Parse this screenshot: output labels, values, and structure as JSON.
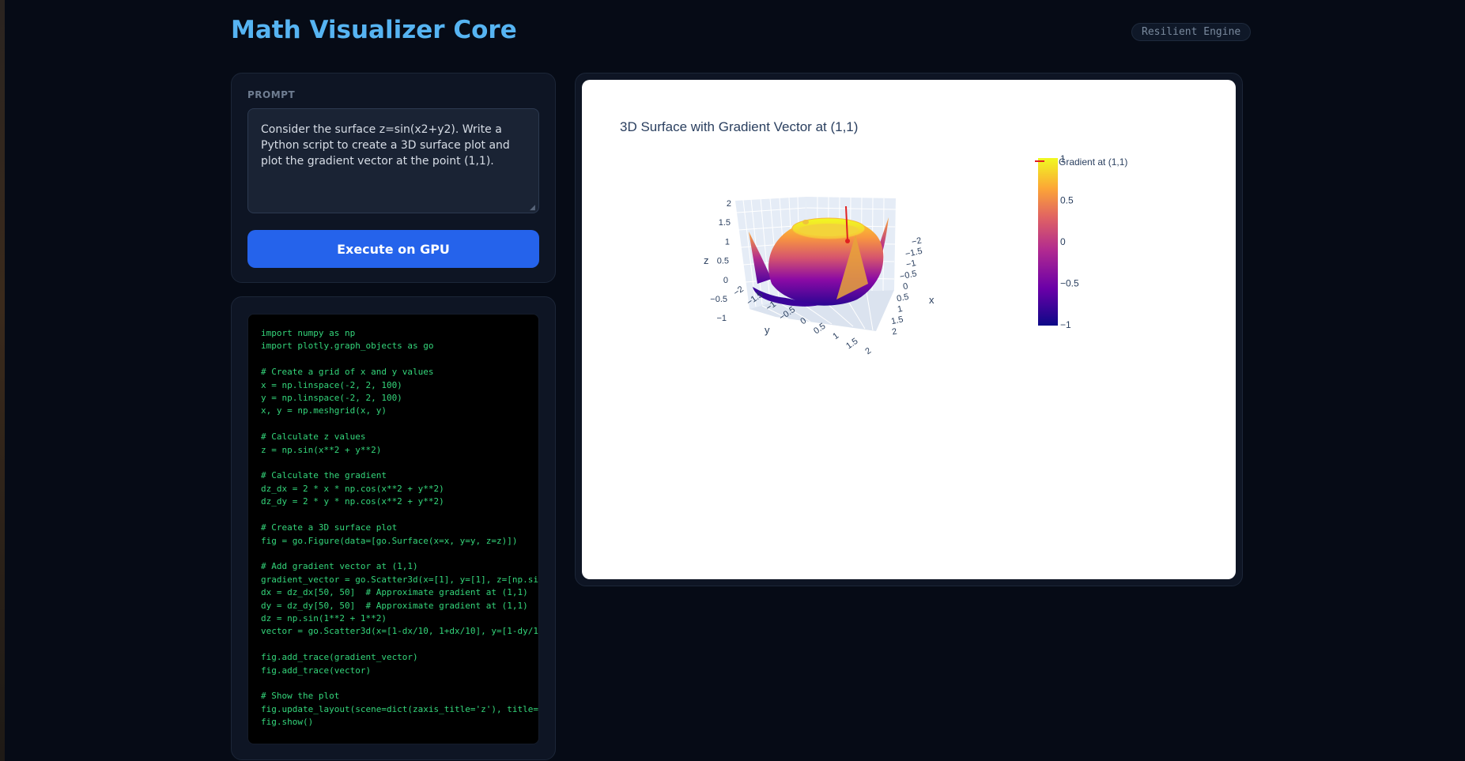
{
  "app": {
    "title": "Math Visualizer Core",
    "badge": "Resilient Engine"
  },
  "prompt": {
    "label": "PROMPT",
    "value": "Consider the surface z=sin(x2+y2). Write a Python script to create a 3D surface plot and plot the gradient vector at the point (1,1).",
    "button_label": "Execute on GPU"
  },
  "code": {
    "text": "import numpy as np\nimport plotly.graph_objects as go\n\n# Create a grid of x and y values\nx = np.linspace(-2, 2, 100)\ny = np.linspace(-2, 2, 100)\nx, y = np.meshgrid(x, y)\n\n# Calculate z values\nz = np.sin(x**2 + y**2)\n\n# Calculate the gradient\ndz_dx = 2 * x * np.cos(x**2 + y**2)\ndz_dy = 2 * y * np.cos(x**2 + y**2)\n\n# Create a 3D surface plot\nfig = go.Figure(data=[go.Surface(x=x, y=y, z=z)])\n\n# Add gradient vector at (1,1)\ngradient_vector = go.Scatter3d(x=[1], y=[1], z=[np.sin(1**2 + 1**2)], mode='markers')\ndx = dz_dx[50, 50]  # Approximate gradient at (1,1)\ndy = dz_dy[50, 50]  # Approximate gradient at (1,1)\ndz = np.sin(1**2 + 1**2)\nvector = go.Scatter3d(x=[1-dx/10, 1+dx/10], y=[1-dy/10, 1+dy/10], z=[dz, dz])\n\nfig.add_trace(gradient_vector)\nfig.add_trace(vector)\n\n# Show the plot\nfig.update_layout(scene=dict(zaxis_title='z'), title='3D Surface with Gradient Vector at (1,1)')\nfig.show()"
  },
  "chart_data": {
    "type": "surface",
    "title": "3D Surface with Gradient Vector at (1,1)",
    "function": "z = sin(x^2 + y^2)",
    "x_range": [
      -2,
      2
    ],
    "y_range": [
      -2,
      2
    ],
    "z_range": [
      -1,
      2
    ],
    "axes": {
      "x": {
        "title": "x",
        "ticks": [
          "2",
          "1.5",
          "1",
          "0.5",
          "0",
          "−0.5",
          "−1",
          "−1.5",
          "−2"
        ]
      },
      "y": {
        "title": "y",
        "ticks": [
          "−2",
          "−1.5",
          "−1",
          "−0.5",
          "0",
          "0.5",
          "1",
          "1.5",
          "2"
        ]
      },
      "z": {
        "title": "z",
        "ticks": [
          "2",
          "1.5",
          "1",
          "0.5",
          "0",
          "−0.5",
          "−1"
        ]
      }
    },
    "colorbar": {
      "ticks": [
        "1",
        "0.5",
        "0",
        "−0.5",
        "−1"
      ],
      "range": [
        -1,
        1
      ]
    },
    "legend": {
      "label": "Gradient at (1,1)",
      "color": "#e02020",
      "placement": "top-right"
    },
    "gradient_point": {
      "x": 1,
      "y": 1
    },
    "colorscale": [
      "#0d0887",
      "#7e03a8",
      "#cc4778",
      "#f89540",
      "#f0f921"
    ]
  }
}
